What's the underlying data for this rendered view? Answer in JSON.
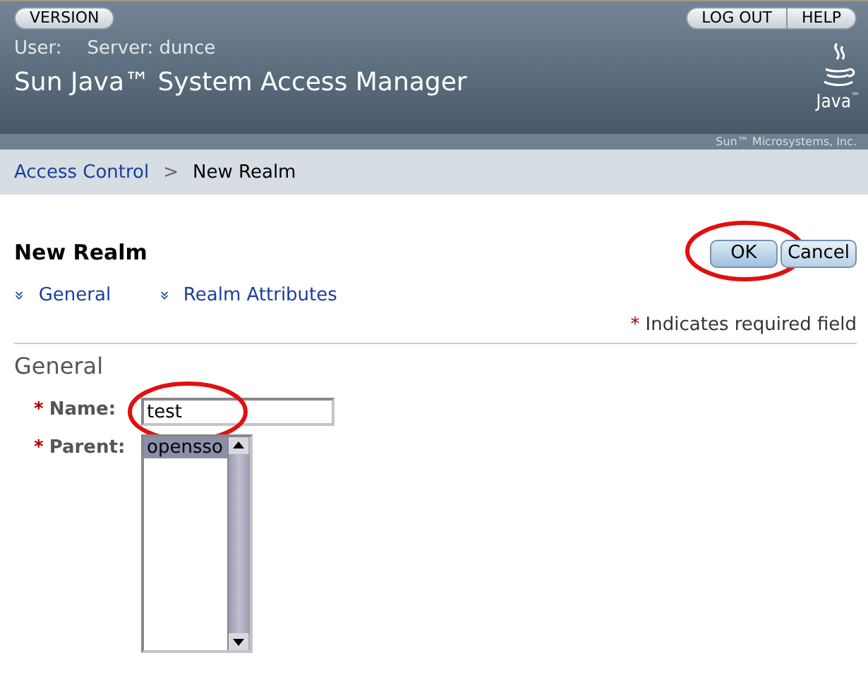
{
  "masthead": {
    "buttons_left": [
      {
        "label": "VERSION"
      }
    ],
    "buttons_right": [
      {
        "label": "LOG OUT"
      },
      {
        "label": "HELP"
      }
    ],
    "user_label": "User:",
    "server_label": "Server: dunce",
    "product_title": "Sun Java™ System Access Manager",
    "logo_text": "Java",
    "logo_tm": "™",
    "company": "Sun™ Microsystems, Inc."
  },
  "breadcrumb": {
    "link": "Access Control",
    "separator": ">",
    "current": "New Realm"
  },
  "page_title": "New Realm",
  "actions": [
    {
      "label": "OK",
      "primary": true,
      "circled": true
    },
    {
      "label": "Cancel",
      "primary": false,
      "circled": false
    }
  ],
  "jump_links": [
    {
      "icon": "»",
      "label": "General"
    },
    {
      "icon": "»",
      "label": "Realm Attributes"
    }
  ],
  "required_note": {
    "mark": "*",
    "text": "Indicates required field"
  },
  "section_title": "General",
  "fields": [
    {
      "kind": "text",
      "required": true,
      "mark": "*",
      "label": "Name:",
      "value": "test",
      "circled": true
    },
    {
      "kind": "list",
      "required": true,
      "mark": "*",
      "label": "Parent:",
      "options": [
        {
          "label": "opensso",
          "selected": true
        }
      ]
    }
  ]
}
